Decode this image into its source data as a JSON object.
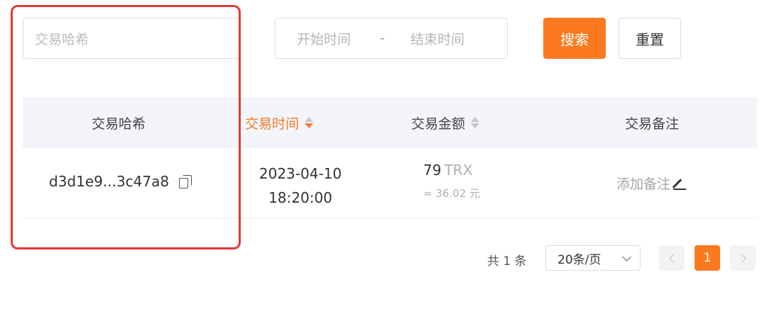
{
  "filters": {
    "hash_placeholder": "交易哈希",
    "date_start_placeholder": "开始时间",
    "date_separator": "-",
    "date_end_placeholder": "结束时间",
    "search_label": "搜索",
    "reset_label": "重置"
  },
  "table": {
    "columns": [
      "交易哈希",
      "交易时间",
      "交易金额",
      "交易备注"
    ],
    "rows": [
      {
        "hash": "d3d1e9...3c47a8",
        "date": "2023-04-10",
        "time": "18:20:00",
        "amount": "79",
        "unit": "TRX",
        "fiat": "≈ 36.02 元",
        "note": "添加备注"
      }
    ]
  },
  "pagination": {
    "total": "共 1 条",
    "page_size": "20条/页",
    "current": "1"
  },
  "colors": {
    "accent": "#fb7a1f",
    "highlight": "#e53935"
  }
}
